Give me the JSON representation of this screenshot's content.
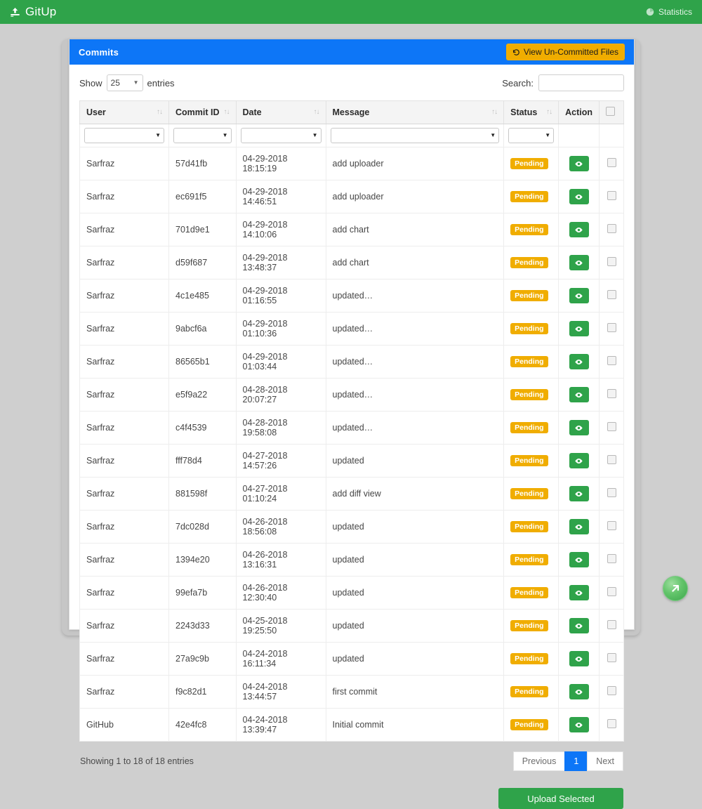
{
  "navbar": {
    "brand": "GitUp",
    "brand_icon": "upload-icon",
    "stats_label": "Statistics",
    "stats_icon": "pie-chart-icon",
    "bg_color": "#2fa34a"
  },
  "panel": {
    "title": "Commits",
    "header_color": "#0d76f7",
    "uncommitted_button": "View Un-Committed Files",
    "uncommitted_icon": "history-icon",
    "uncommitted_color": "#f0ad00"
  },
  "controls": {
    "show_label": "Show",
    "entries_label": "entries",
    "page_length": "25",
    "search_label": "Search:",
    "search_value": "",
    "search_placeholder": ""
  },
  "table": {
    "columns": [
      {
        "label": "User",
        "sortable": true
      },
      {
        "label": "Commit ID",
        "sortable": true
      },
      {
        "label": "Date",
        "sortable": true
      },
      {
        "label": "Message",
        "sortable": true
      },
      {
        "label": "Status",
        "sortable": true
      },
      {
        "label": "Action",
        "sortable": false
      },
      {
        "label": "",
        "sortable": false
      }
    ],
    "filters": [
      "",
      "",
      "",
      "",
      ""
    ],
    "rows": [
      {
        "user": "Sarfraz",
        "commit_id": "57d41fb",
        "date": "04-29-2018 18:15:19",
        "message": "add uploader",
        "status": "Pending"
      },
      {
        "user": "Sarfraz",
        "commit_id": "ec691f5",
        "date": "04-29-2018 14:46:51",
        "message": "add uploader",
        "status": "Pending"
      },
      {
        "user": "Sarfraz",
        "commit_id": "701d9e1",
        "date": "04-29-2018 14:10:06",
        "message": "add chart",
        "status": "Pending"
      },
      {
        "user": "Sarfraz",
        "commit_id": "d59f687",
        "date": "04-29-2018 13:48:37",
        "message": "add chart",
        "status": "Pending"
      },
      {
        "user": "Sarfraz",
        "commit_id": "4c1e485",
        "date": "04-29-2018 01:16:55",
        "message": "updated…",
        "status": "Pending"
      },
      {
        "user": "Sarfraz",
        "commit_id": "9abcf6a",
        "date": "04-29-2018 01:10:36",
        "message": "updated…",
        "status": "Pending"
      },
      {
        "user": "Sarfraz",
        "commit_id": "86565b1",
        "date": "04-29-2018 01:03:44",
        "message": "updated…",
        "status": "Pending"
      },
      {
        "user": "Sarfraz",
        "commit_id": "e5f9a22",
        "date": "04-28-2018 20:07:27",
        "message": "updated…",
        "status": "Pending"
      },
      {
        "user": "Sarfraz",
        "commit_id": "c4f4539",
        "date": "04-28-2018 19:58:08",
        "message": "updated…",
        "status": "Pending"
      },
      {
        "user": "Sarfraz",
        "commit_id": "fff78d4",
        "date": "04-27-2018 14:57:26",
        "message": "updated",
        "status": "Pending"
      },
      {
        "user": "Sarfraz",
        "commit_id": "881598f",
        "date": "04-27-2018 01:10:24",
        "message": "add diff view",
        "status": "Pending"
      },
      {
        "user": "Sarfraz",
        "commit_id": "7dc028d",
        "date": "04-26-2018 18:56:08",
        "message": "updated",
        "status": "Pending"
      },
      {
        "user": "Sarfraz",
        "commit_id": "1394e20",
        "date": "04-26-2018 13:16:31",
        "message": "updated",
        "status": "Pending"
      },
      {
        "user": "Sarfraz",
        "commit_id": "99efa7b",
        "date": "04-26-2018 12:30:40",
        "message": "updated",
        "status": "Pending"
      },
      {
        "user": "Sarfraz",
        "commit_id": "2243d33",
        "date": "04-25-2018 19:25:50",
        "message": "updated",
        "status": "Pending"
      },
      {
        "user": "Sarfraz",
        "commit_id": "27a9c9b",
        "date": "04-24-2018 16:11:34",
        "message": "updated",
        "status": "Pending"
      },
      {
        "user": "Sarfraz",
        "commit_id": "f9c82d1",
        "date": "04-24-2018 13:44:57",
        "message": "first commit",
        "status": "Pending"
      },
      {
        "user": "GitHub",
        "commit_id": "42e4fc8",
        "date": "04-24-2018 13:39:47",
        "message": "Initial commit",
        "status": "Pending"
      }
    ],
    "action_icon": "eye-icon",
    "status_color": "#f0ad00"
  },
  "footer": {
    "info": "Showing 1 to 18 of 18 entries",
    "previous_label": "Previous",
    "next_label": "Next",
    "current_page": "1"
  },
  "upload": {
    "label": "Upload Selected",
    "color": "#2fa34a"
  },
  "fab": {
    "icon": "arrow-up-right-icon"
  }
}
